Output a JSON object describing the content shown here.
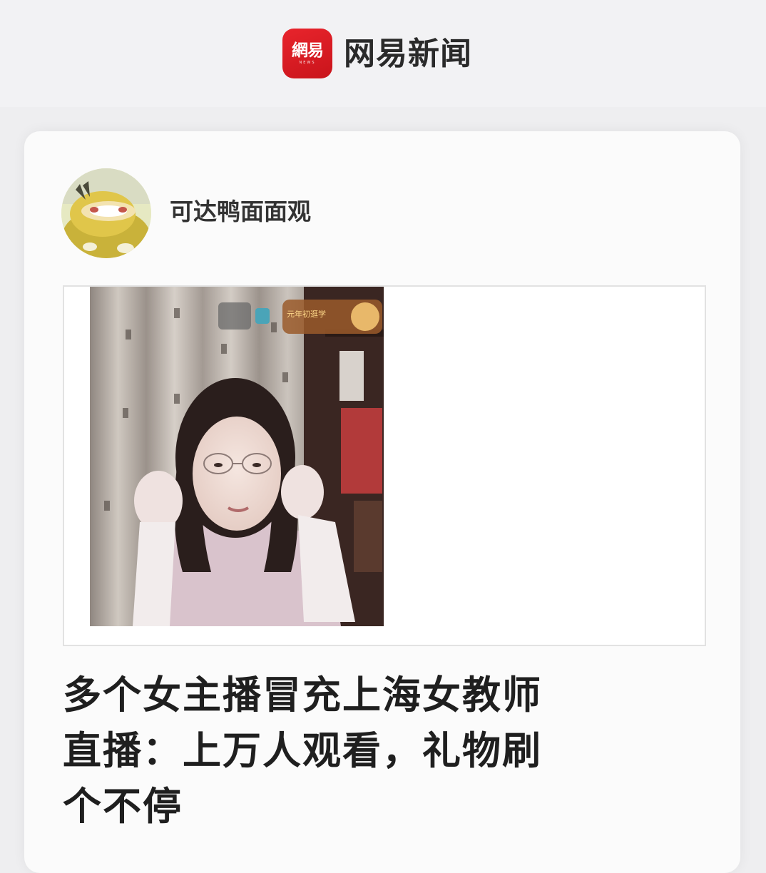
{
  "brand": {
    "logo_text": "網易",
    "logo_subtext": "NEWS",
    "app_name": "网易新闻",
    "brand_color": "#d81e22"
  },
  "author": {
    "name": "可达鸭面面观",
    "avatar_icon": "psyduck-avatar"
  },
  "video": {
    "thumbnail_icon": "livestream-frame",
    "overlay_badge": "元年初逛学"
  },
  "article": {
    "headline_lines": [
      "多个女主播冒充上海女教师",
      "直播：上万人观看，礼物刷",
      "个不停"
    ]
  }
}
